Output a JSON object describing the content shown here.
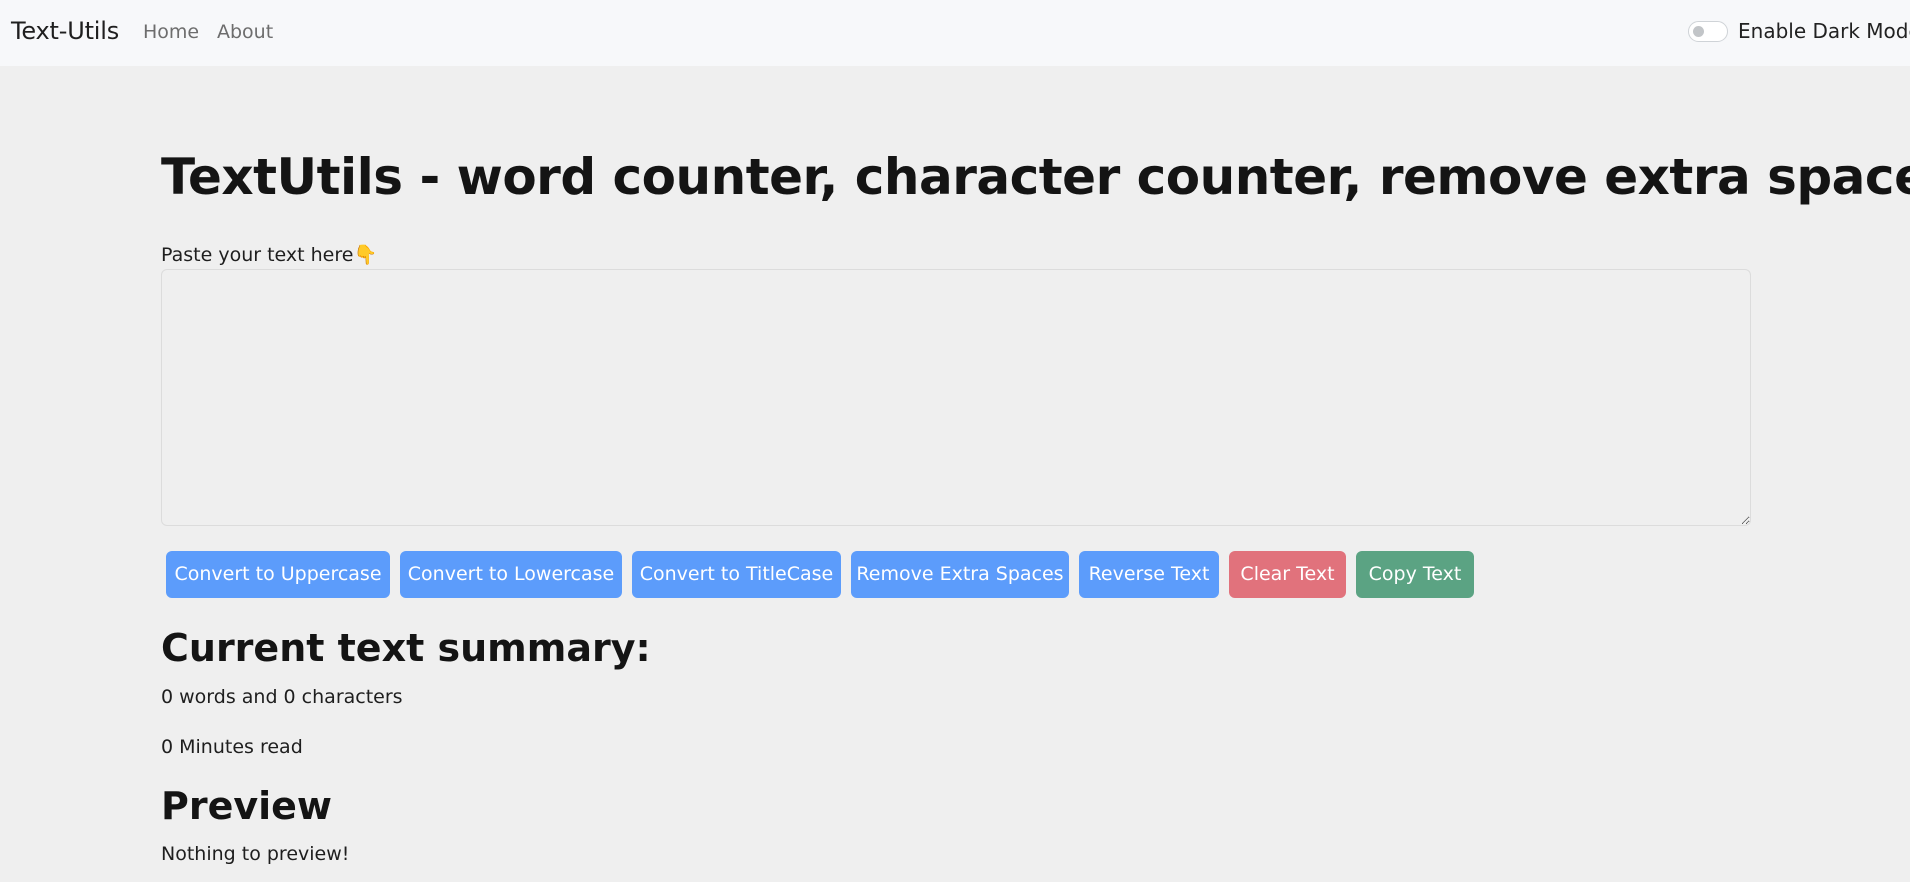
{
  "navbar": {
    "brand": "Text-Utils",
    "links": [
      "Home",
      "About"
    ],
    "dark_mode_label": "Enable Dark Mode"
  },
  "main": {
    "title": "TextUtils - word counter, character counter, remove extra spaces",
    "paste_label": "Paste your text here👇",
    "textarea_value": "",
    "buttons": [
      {
        "label": "Convert to Uppercase",
        "color": "#5c9cfb"
      },
      {
        "label": "Convert to Lowercase",
        "color": "#5c9cfb"
      },
      {
        "label": "Convert to TitleCase",
        "color": "#5c9cfb"
      },
      {
        "label": "Remove Extra Spaces",
        "color": "#5c9cfb"
      },
      {
        "label": "Reverse Text",
        "color": "#5c9cfb"
      },
      {
        "label": "Clear Text",
        "color": "#e1727c"
      },
      {
        "label": "Copy Text",
        "color": "#5ba383"
      }
    ]
  },
  "summary": {
    "heading": "Current text summary:",
    "words_line": "0 words and 0 characters",
    "minutes_line": "0 Minutes read"
  },
  "preview": {
    "heading": "Preview",
    "text": "Nothing to preview!"
  }
}
